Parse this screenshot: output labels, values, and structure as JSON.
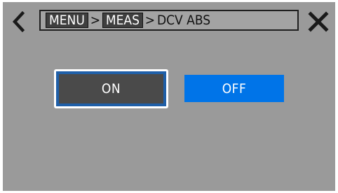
{
  "breadcrumb": {
    "items": [
      "MENU",
      "MEAS"
    ],
    "separator": ">",
    "current": "DCV ABS"
  },
  "icons": {
    "back": "chevron-left-icon",
    "close": "close-x-icon"
  },
  "options": {
    "on_label": "ON",
    "off_label": "OFF",
    "selected": "ON"
  },
  "colors": {
    "background": "#9a9a9a",
    "crumb_box": "#3f3f3f",
    "selected_button": "#4a4a4a",
    "selected_outline": "#1f5fa8",
    "unselected_button": "#0074e8"
  }
}
